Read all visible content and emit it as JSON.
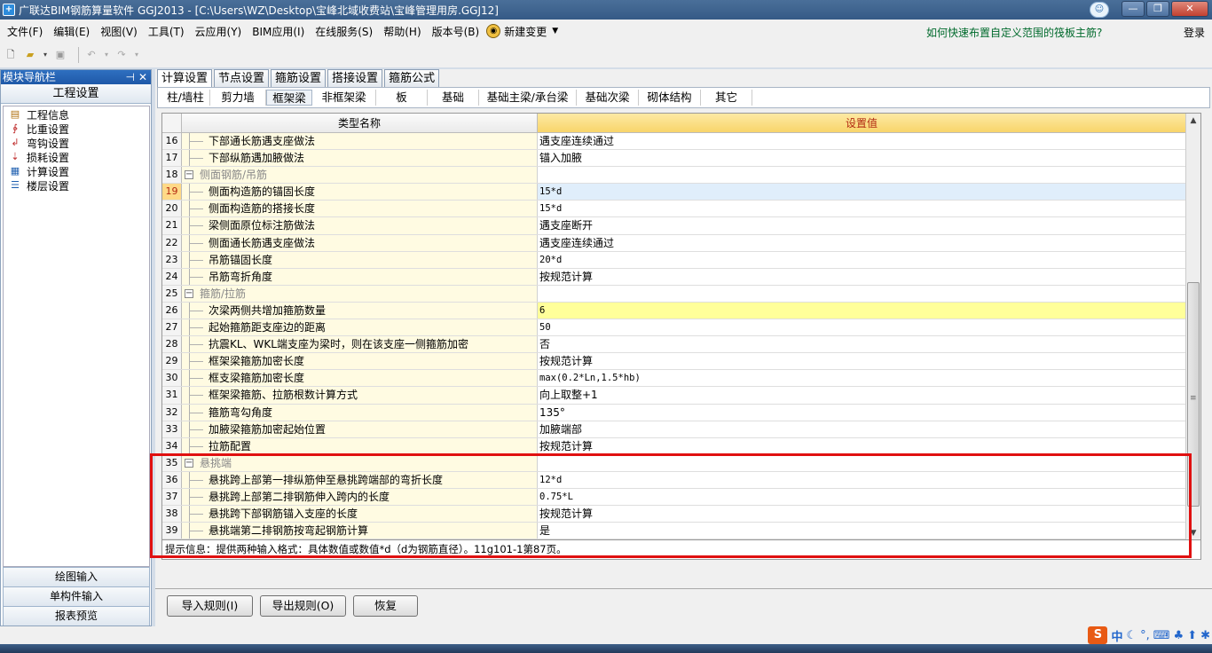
{
  "window": {
    "title": "广联达BIM钢筋算量软件 GGJ2013 - [C:\\Users\\WZ\\Desktop\\宝峰北域收费站\\宝峰管理用房.GGJ12]"
  },
  "menu": {
    "items": [
      "文件(F)",
      "编辑(E)",
      "视图(V)",
      "工具(T)",
      "云应用(Y)",
      "BIM应用(I)",
      "在线服务(S)",
      "帮助(H)",
      "版本号(B)"
    ],
    "new_change": "新建变更",
    "help_link": "如何快速布置自定义范围的筏板主筋?",
    "login": "登录"
  },
  "leftnav": {
    "header": "模块导航栏",
    "section": "工程设置",
    "items": [
      {
        "label": "工程信息",
        "icon": "info-icon"
      },
      {
        "label": "比重设置",
        "icon": "weight-icon"
      },
      {
        "label": "弯钩设置",
        "icon": "hook-icon"
      },
      {
        "label": "损耗设置",
        "icon": "loss-icon"
      },
      {
        "label": "计算设置",
        "icon": "calc-icon"
      },
      {
        "label": "楼层设置",
        "icon": "floor-icon"
      }
    ],
    "bottom": [
      "绘图输入",
      "单构件输入",
      "报表预览"
    ]
  },
  "tabs": {
    "top": [
      "计算设置",
      "节点设置",
      "箍筋设置",
      "搭接设置",
      "箍筋公式"
    ],
    "sub": [
      "柱/墙柱",
      "剪力墙",
      "框架梁",
      "非框架梁",
      "板",
      "基础",
      "基础主梁/承台梁",
      "基础次梁",
      "砌体结构",
      "其它"
    ]
  },
  "grid": {
    "col_name": "类型名称",
    "col_value": "设置值",
    "rows": [
      {
        "num": "16",
        "name": "下部通长筋遇支座做法",
        "value": "遇支座连续通过"
      },
      {
        "num": "17",
        "name": "下部纵筋遇加腋做法",
        "value": "锚入加腋"
      },
      {
        "num": "18",
        "name": "侧面钢筋/吊筋",
        "value": "",
        "group": true
      },
      {
        "num": "19",
        "name": "侧面构造筋的锚固长度",
        "value": "15*d",
        "selected": true,
        "mono": true
      },
      {
        "num": "20",
        "name": "侧面构造筋的搭接长度",
        "value": "15*d",
        "mono": true
      },
      {
        "num": "21",
        "name": "梁侧面原位标注筋做法",
        "value": "遇支座断开"
      },
      {
        "num": "22",
        "name": "侧面通长筋遇支座做法",
        "value": "遇支座连续通过"
      },
      {
        "num": "23",
        "name": "吊筋锚固长度",
        "value": "20*d",
        "mono": true
      },
      {
        "num": "24",
        "name": "吊筋弯折角度",
        "value": "按规范计算"
      },
      {
        "num": "25",
        "name": "箍筋/拉筋",
        "value": "",
        "group": true
      },
      {
        "num": "26",
        "name": "次梁两侧共增加箍筋数量",
        "value": "6",
        "highlight": true,
        "mono": true
      },
      {
        "num": "27",
        "name": "起始箍筋距支座边的距离",
        "value": "50",
        "mono": true
      },
      {
        "num": "28",
        "name": "抗震KL、WKL端支座为梁时，则在该支座一侧箍筋加密",
        "value": "否"
      },
      {
        "num": "29",
        "name": "框架梁箍筋加密长度",
        "value": "按规范计算"
      },
      {
        "num": "30",
        "name": "框支梁箍筋加密长度",
        "value": "max(0.2*Ln,1.5*hb)",
        "mono": true
      },
      {
        "num": "31",
        "name": "框架梁箍筋、拉筋根数计算方式",
        "value": "向上取整+1"
      },
      {
        "num": "32",
        "name": "箍筋弯勾角度",
        "value": "135°"
      },
      {
        "num": "33",
        "name": "加腋梁箍筋加密起始位置",
        "value": "加腋端部"
      },
      {
        "num": "34",
        "name": "拉筋配置",
        "value": "按规范计算"
      },
      {
        "num": "35",
        "name": "悬挑端",
        "value": "",
        "group": true
      },
      {
        "num": "36",
        "name": "悬挑跨上部第一排纵筋伸至悬挑跨端部的弯折长度",
        "value": "12*d",
        "mono": true
      },
      {
        "num": "37",
        "name": "悬挑跨上部第二排钢筋伸入跨内的长度",
        "value": "0.75*L",
        "mono": true
      },
      {
        "num": "38",
        "name": "悬挑跨下部钢筋锚入支座的长度",
        "value": "按规范计算"
      },
      {
        "num": "39",
        "name": "悬挑端第二排钢筋按弯起钢筋计算",
        "value": "是"
      }
    ],
    "hint": "提示信息：提供两种输入格式：具体数值或数值*d（d为钢筋直径）。11g101-1第87页。"
  },
  "buttons": {
    "import": "导入规则(I)",
    "export": "导出规则(O)",
    "restore": "恢复"
  },
  "ime": {
    "lang": "中"
  },
  "colors": {
    "highlight_box": "#e01010",
    "header_value_bg": "#f8d56a"
  }
}
